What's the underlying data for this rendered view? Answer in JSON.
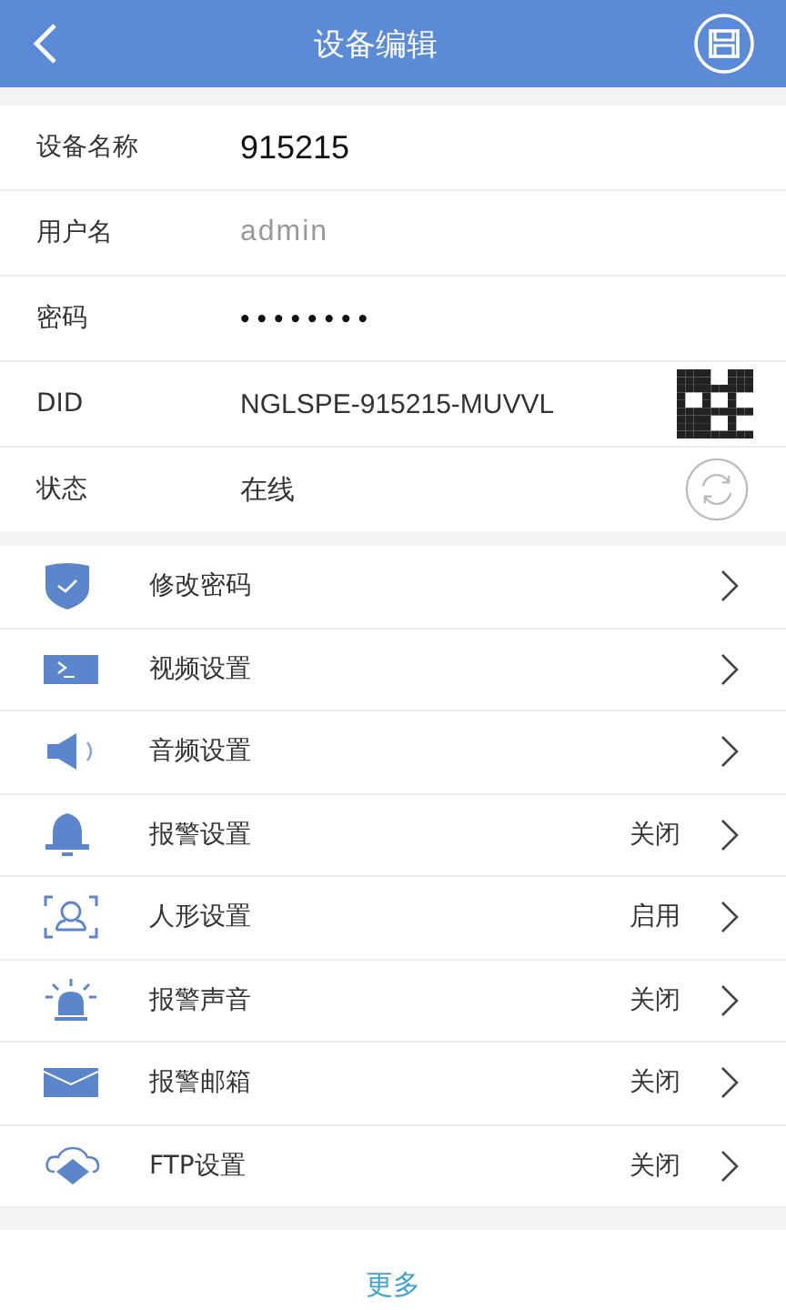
{
  "header": {
    "title": "设备编辑"
  },
  "fields": [
    {
      "label": "设备名称",
      "value": "915215",
      "kind": "strong"
    },
    {
      "label": "用户名",
      "value": "admin",
      "kind": "muted"
    },
    {
      "label": "密码",
      "value": "••••••••",
      "kind": "secret"
    },
    {
      "label": "DID",
      "value": "NGLSPE-915215-MUVVL",
      "kind": "plain"
    },
    {
      "label": "状态",
      "value": "在线",
      "kind": "plain"
    }
  ],
  "menu": [
    {
      "label": "修改密码"
    },
    {
      "label": "视频设置"
    },
    {
      "label": "音频设置"
    },
    {
      "label": "报警设置",
      "status": "关闭"
    },
    {
      "label": "人形设置",
      "status": "启用"
    },
    {
      "label": "报警声音",
      "status": "关闭"
    },
    {
      "label": "报警邮箱",
      "status": "关闭"
    },
    {
      "label": "FTP设置",
      "status": "关闭"
    }
  ],
  "more": "更多"
}
